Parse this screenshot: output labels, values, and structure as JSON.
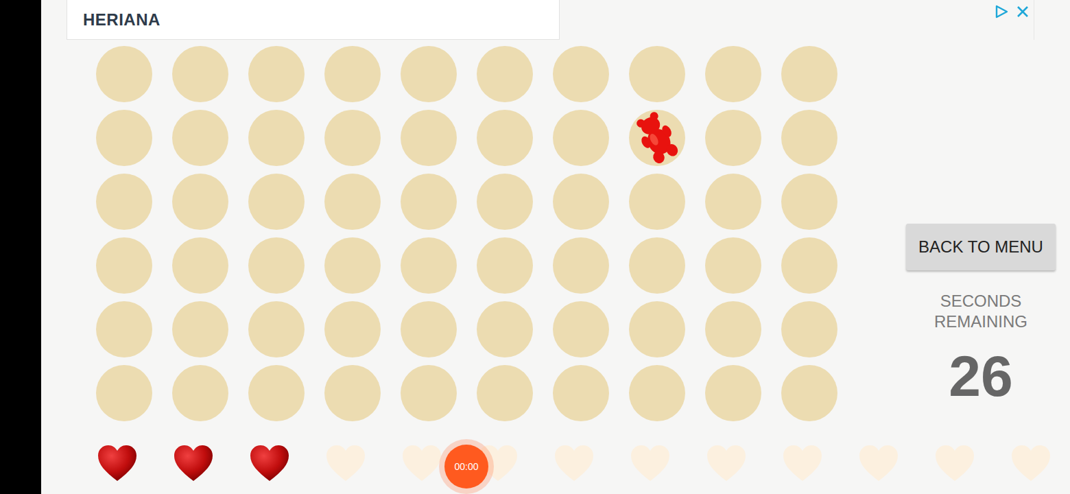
{
  "ad": {
    "title": "HERIANA"
  },
  "board": {
    "rows": [
      {
        "cells": [
          {
            "occupied": false
          },
          {
            "occupied": false
          },
          {
            "occupied": false
          },
          {
            "occupied": false
          },
          {
            "occupied": false
          },
          {
            "occupied": false
          },
          {
            "occupied": false
          },
          {
            "occupied": false
          },
          {
            "occupied": false
          },
          {
            "occupied": false
          }
        ]
      },
      {
        "cells": [
          {
            "occupied": false
          },
          {
            "occupied": false
          },
          {
            "occupied": false
          },
          {
            "occupied": false
          },
          {
            "occupied": false
          },
          {
            "occupied": false
          },
          {
            "occupied": false
          },
          {
            "occupied": true
          },
          {
            "occupied": false
          },
          {
            "occupied": false
          }
        ]
      },
      {
        "cells": [
          {
            "occupied": false
          },
          {
            "occupied": false
          },
          {
            "occupied": false
          },
          {
            "occupied": false
          },
          {
            "occupied": false
          },
          {
            "occupied": false
          },
          {
            "occupied": false
          },
          {
            "occupied": false
          },
          {
            "occupied": false
          },
          {
            "occupied": false
          }
        ]
      },
      {
        "cells": [
          {
            "occupied": false
          },
          {
            "occupied": false
          },
          {
            "occupied": false
          },
          {
            "occupied": false
          },
          {
            "occupied": false
          },
          {
            "occupied": false
          },
          {
            "occupied": false
          },
          {
            "occupied": false
          },
          {
            "occupied": false
          },
          {
            "occupied": false
          }
        ]
      },
      {
        "cells": [
          {
            "occupied": false
          },
          {
            "occupied": false
          },
          {
            "occupied": false
          },
          {
            "occupied": false
          },
          {
            "occupied": false
          },
          {
            "occupied": false
          },
          {
            "occupied": false
          },
          {
            "occupied": false
          },
          {
            "occupied": false
          },
          {
            "occupied": false
          }
        ]
      },
      {
        "cells": [
          {
            "occupied": false
          },
          {
            "occupied": false
          },
          {
            "occupied": false
          },
          {
            "occupied": false
          },
          {
            "occupied": false
          },
          {
            "occupied": false
          },
          {
            "occupied": false
          },
          {
            "occupied": false
          },
          {
            "occupied": false
          },
          {
            "occupied": false
          }
        ]
      }
    ]
  },
  "menu_button": {
    "label": "BACK TO MENU"
  },
  "timer": {
    "label": "SECONDS REMAINING",
    "value": "26"
  },
  "lives": [
    {
      "filled": true
    },
    {
      "filled": true
    },
    {
      "filled": true
    },
    {
      "filled": false
    },
    {
      "filled": false
    },
    {
      "filled": false
    },
    {
      "filled": false
    },
    {
      "filled": false
    },
    {
      "filled": false
    },
    {
      "filled": false
    },
    {
      "filled": false
    },
    {
      "filled": false
    },
    {
      "filled": false
    }
  ],
  "recorder": {
    "time": "00:00"
  }
}
